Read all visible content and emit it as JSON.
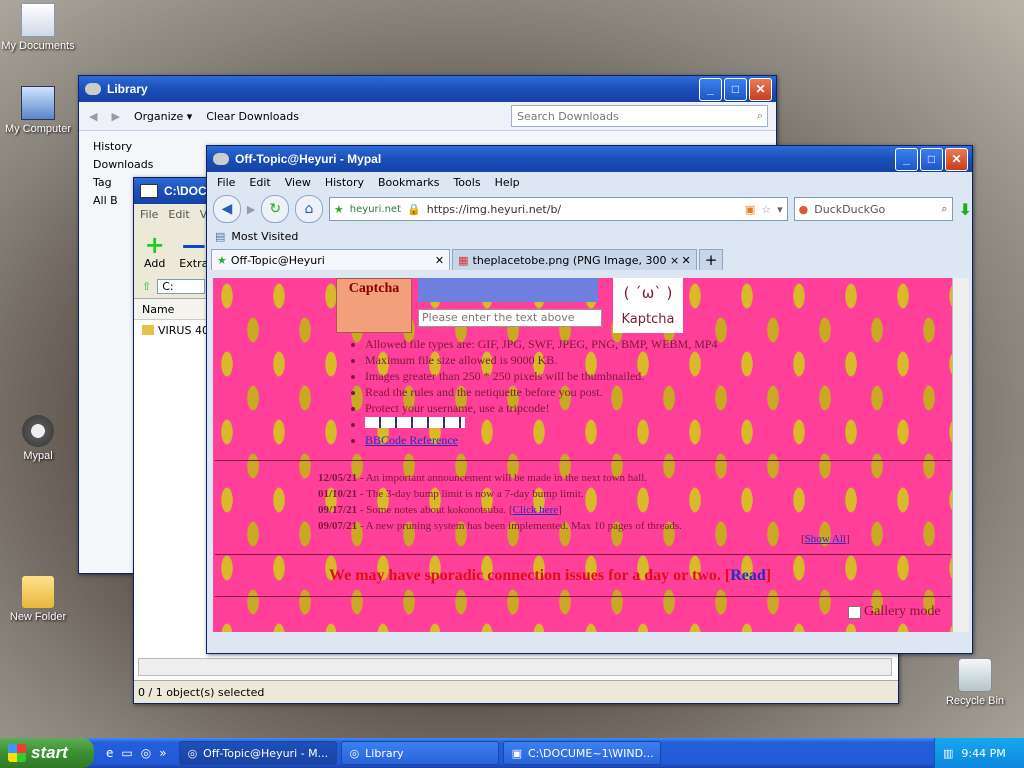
{
  "desktop": {
    "icons": [
      {
        "label": "My Documents",
        "icon": "my-documents-icon"
      },
      {
        "label": "My Computer",
        "icon": "my-computer-icon"
      },
      {
        "label": "Mypal",
        "icon": "mypal-raccoon-icon"
      },
      {
        "label": "New Folder",
        "icon": "folder-icon"
      },
      {
        "label": "Recycle Bin",
        "icon": "recycle-bin-icon"
      }
    ]
  },
  "library": {
    "title": "Library",
    "organize": "Organize",
    "clear_downloads": "Clear Downloads",
    "search_placeholder": "Search Downloads",
    "tree": [
      "History",
      "Downloads",
      "Tag",
      "All B"
    ]
  },
  "explorer": {
    "title": "C:\\DOCU",
    "menu": [
      "File",
      "Edit",
      "Vie"
    ],
    "add_label": "Add",
    "extract_label": "Extra",
    "address": "C:",
    "column_name": "Name",
    "file_name": "VIRUS 40",
    "status": "0 / 1 object(s) selected"
  },
  "browser": {
    "title": "Off-Topic@Heyuri - Mypal",
    "menu": [
      "File",
      "Edit",
      "View",
      "History",
      "Bookmarks",
      "Tools",
      "Help"
    ],
    "site_label": "heyuri.net",
    "url": "https://img.heyuri.net/b/",
    "search_engine": "DuckDuckGo",
    "bookmark": "Most Visited",
    "tabs": [
      "Off-Topic@Heyuri",
      "theplacetobe.png (PNG Image, 300 × 100 ..."
    ]
  },
  "page": {
    "captcha_label": "Captcha",
    "captcha_placeholder": "Please enter the text above",
    "kaptcha_face": "( ´ω` )",
    "kaptcha_label": "Kaptcha",
    "rules": [
      "Allowed file types are: GIF, JPG, SWF, JPEG, PNG, BMP, WEBM, MP4",
      "Maximum file size allowed is 9000 KB.",
      "Images greater than 250 * 250 pixels will be thumbnailed.",
      "Read the rules and the netiquette before you post.",
      "Protect your username, use a tripcode!",
      "BBCode Reference"
    ],
    "news": [
      {
        "date": "12/05/21",
        "text": " - An important announcement will be made in the next town hall."
      },
      {
        "date": "01/10/21",
        "text": " - The 3-day bump limit is now a 7-day bump limit."
      },
      {
        "date": "09/17/21",
        "text": " - Some notes about kokonotsuba. ",
        "link": "Click here"
      },
      {
        "date": "09/07/21",
        "text": " - A new pruning system has been implemented. Max 10 pages of threads."
      }
    ],
    "show_all": "Show All",
    "notice": "We may have sporadic connection issues for a day or two.",
    "notice_link": "Read",
    "gallery_mode": "Gallery mode"
  },
  "taskbar": {
    "start": "start",
    "tasks": [
      "Off-Topic@Heyuri - M...",
      "Library",
      "C:\\DOCUME~1\\WIND..."
    ],
    "clock": "9:44 PM"
  },
  "colors": {
    "xp_blue": "#245edb",
    "page_pink": "#ff3f9a",
    "banana_yellow": "#d8b92a",
    "notice_red": "#e0101a"
  }
}
